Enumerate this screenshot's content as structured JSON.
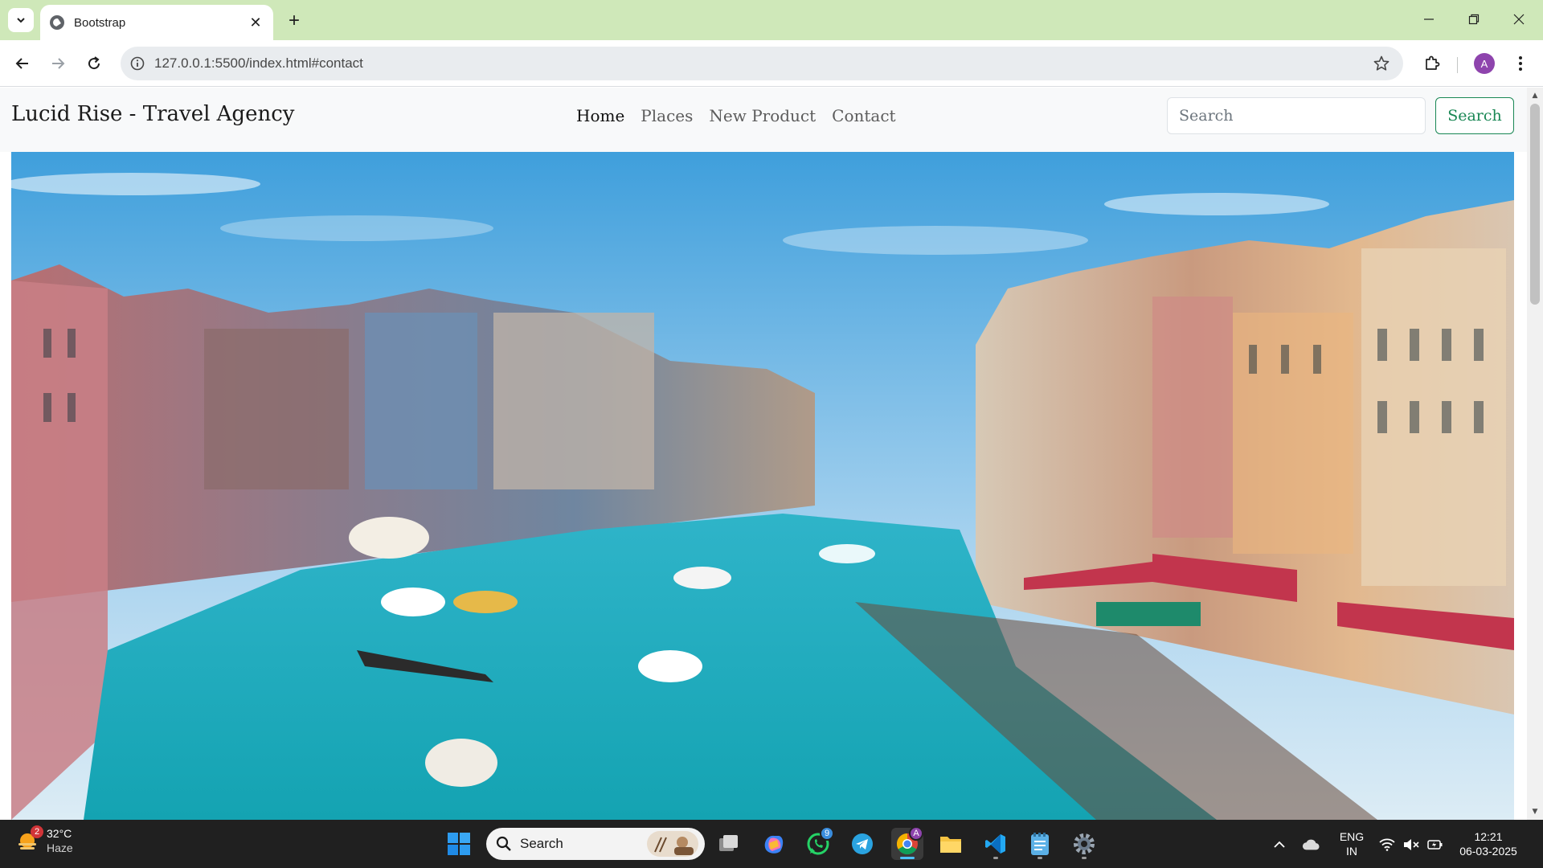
{
  "browser": {
    "tab_title": "Bootstrap",
    "url": "127.0.0.1:5500/index.html#contact",
    "profile_initial": "A"
  },
  "page": {
    "brand": "Lucid Rise - Travel Agency",
    "nav": [
      {
        "label": "Home",
        "active": true
      },
      {
        "label": "Places",
        "active": false
      },
      {
        "label": "New Product",
        "active": false
      },
      {
        "label": "Contact",
        "active": false
      }
    ],
    "search_placeholder": "Search",
    "search_button": "Search",
    "hero_alt_icon": "venice-canal-photo"
  },
  "taskbar": {
    "weather_temp": "32°C",
    "weather_desc": "Haze",
    "weather_badge": "2",
    "search_label": "Search",
    "whatsapp_badge": "9",
    "chrome_badge": "A",
    "lang_top": "ENG",
    "lang_bottom": "IN",
    "time": "12:21",
    "date": "06-03-2025"
  },
  "colors": {
    "tabstrip": "#cfe8b9",
    "success": "#198754",
    "taskbar": "#202020"
  }
}
